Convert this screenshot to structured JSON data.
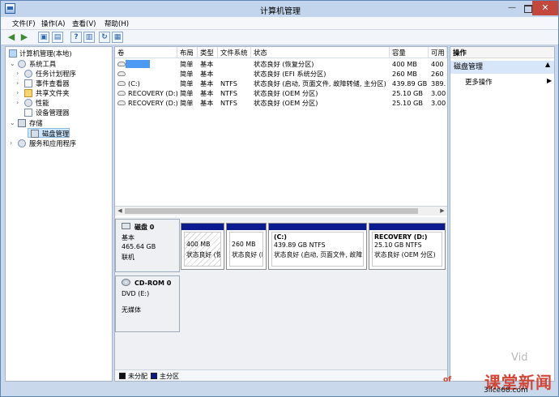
{
  "window": {
    "title": "计算机管理",
    "controls": {
      "minimize": "—",
      "close": "✕"
    }
  },
  "menu": [
    "文件(F)",
    "操作(A)",
    "查看(V)",
    "帮助(H)"
  ],
  "tree": [
    {
      "label": "计算机管理(本地)",
      "icon": "computer-management-icon"
    },
    {
      "label": "系统工具",
      "icon": "tools-icon"
    },
    {
      "label": "任务计划程序",
      "icon": "clock-icon"
    },
    {
      "label": "事件查看器",
      "icon": "event-viewer-icon"
    },
    {
      "label": "共享文件夹",
      "icon": "shared-folder-icon"
    },
    {
      "label": "性能",
      "icon": "performance-icon"
    },
    {
      "label": "设备管理器",
      "icon": "device-manager-icon"
    },
    {
      "label": "存储",
      "icon": "storage-icon"
    },
    {
      "label": "磁盘管理",
      "icon": "disk-management-icon"
    },
    {
      "label": "服务和应用程序",
      "icon": "services-icon"
    }
  ],
  "volumes": {
    "headers": [
      "卷",
      "布局",
      "类型",
      "文件系统",
      "状态",
      "容量",
      "可用"
    ],
    "rows": [
      [
        "",
        "简单",
        "基本",
        "",
        "状态良好 (恢复分区)",
        "400 MB",
        "400"
      ],
      [
        "",
        "简单",
        "基本",
        "",
        "状态良好 (EFI 系统分区)",
        "260 MB",
        "260"
      ],
      [
        "(C:)",
        "简单",
        "基本",
        "NTFS",
        "状态良好 (启动, 页面文件, 故障转储, 主分区)",
        "439.89 GB",
        "389."
      ],
      [
        "RECOVERY (D:)",
        "简单",
        "基本",
        "NTFS",
        "状态良好 (OEM 分区)",
        "25.10 GB",
        "3.00"
      ],
      [
        "RECOVERY (D:)",
        "简单",
        "基本",
        "NTFS",
        "状态良好 (OEM 分区)",
        "25.10 GB",
        "3.00"
      ]
    ]
  },
  "disks": [
    {
      "name": "磁盘 0",
      "type": "基本",
      "size": "465.64 GB",
      "status": "联机",
      "partitions": [
        {
          "title": "",
          "line1": "400 MB",
          "line2": "状态良好 (恢"
        },
        {
          "title": "",
          "line1": "260 MB",
          "line2": "状态良好 (E"
        },
        {
          "title": "(C:)",
          "line1": "439.89 GB NTFS",
          "line2": "状态良好 (启动, 页面文件, 故障"
        },
        {
          "title": "RECOVERY  (D:)",
          "line1": "25.10 GB NTFS",
          "line2": "状态良好 (OEM 分区)"
        }
      ]
    },
    {
      "name": "CD-ROM 0",
      "type": "DVD (E:)",
      "status": "无媒体"
    }
  ],
  "legend": [
    {
      "label": "未分配",
      "color": "#111111"
    },
    {
      "label": "主分区",
      "color": "#0b1b8f"
    }
  ],
  "actions": {
    "title": "操作",
    "section": "磁盘管理",
    "more": "更多操作"
  },
  "watermark": {
    "main": "课堂新闻",
    "left": "of",
    "right": "Vid",
    "url": "3ilce68.com"
  }
}
